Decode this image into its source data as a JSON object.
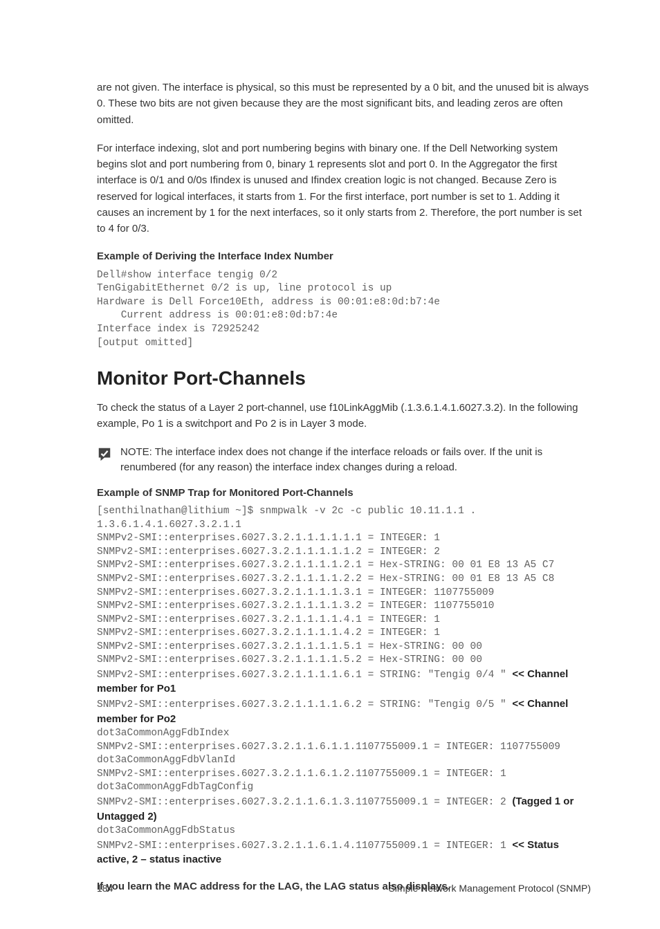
{
  "intro": {
    "p1": "are not given. The interface is physical, so this must be represented by a 0 bit, and the unused bit is always 0. These two bits are not given because they are the most significant bits, and leading zeros are often omitted.",
    "p2": "For interface indexing, slot and port numbering begins with binary one. If the Dell Networking system begins slot and port numbering from 0, binary 1 represents slot and port 0. In the Aggregator the first interface is 0/1 and 0/0s Ifindex is unused and Ifindex creation logic is not changed. Because Zero is reserved for logical interfaces, it starts from 1. For the first interface, port number is set to 1. Adding it causes an increment by 1 for the next interfaces, so it only starts from 2. Therefore, the port number is set to 4 for 0/3."
  },
  "example1": {
    "title": "Example of Deriving the Interface Index Number",
    "code": "Dell#show interface tengig 0/2\nTenGigabitEthernet 0/2 is up, line protocol is up\nHardware is Dell Force10Eth, address is 00:01:e8:0d:b7:4e\n    Current address is 00:01:e8:0d:b7:4e\nInterface index is 72925242\n[output omitted]"
  },
  "section": {
    "title": "Monitor Port-Channels",
    "body": "To check the status of a Layer 2 port-channel, use f10LinkAggMib (.1.3.6.1.4.1.6027.3.2). In the following example, Po 1 is a switchport and Po 2 is in Layer 3 mode."
  },
  "note": {
    "label": "NOTE:",
    "text": " The interface index does not change if the interface reloads or fails over. If the unit is renumbered (for any reason) the interface index changes during a reload."
  },
  "example2": {
    "title": "Example of SNMP Trap for Monitored Port-Channels",
    "lines": [
      {
        "code": "[senthilnathan@lithium ~]$ snmpwalk -v 2c -c public 10.11.1.1 .",
        "anno": ""
      },
      {
        "code": "1.3.6.1.4.1.6027.3.2.1.1",
        "anno": ""
      },
      {
        "code": "SNMPv2-SMI::enterprises.6027.3.2.1.1.1.1.1.1 = INTEGER: 1",
        "anno": ""
      },
      {
        "code": "SNMPv2-SMI::enterprises.6027.3.2.1.1.1.1.1.2 = INTEGER: 2",
        "anno": ""
      },
      {
        "code": "SNMPv2-SMI::enterprises.6027.3.2.1.1.1.1.2.1 = Hex-STRING: 00 01 E8 13 A5 C7",
        "anno": ""
      },
      {
        "code": "SNMPv2-SMI::enterprises.6027.3.2.1.1.1.1.2.2 = Hex-STRING: 00 01 E8 13 A5 C8",
        "anno": ""
      },
      {
        "code": "SNMPv2-SMI::enterprises.6027.3.2.1.1.1.1.3.1 = INTEGER: 1107755009",
        "anno": ""
      },
      {
        "code": "SNMPv2-SMI::enterprises.6027.3.2.1.1.1.1.3.2 = INTEGER: 1107755010",
        "anno": ""
      },
      {
        "code": "SNMPv2-SMI::enterprises.6027.3.2.1.1.1.1.4.1 = INTEGER: 1",
        "anno": ""
      },
      {
        "code": "SNMPv2-SMI::enterprises.6027.3.2.1.1.1.1.4.2 = INTEGER: 1",
        "anno": ""
      },
      {
        "code": "SNMPv2-SMI::enterprises.6027.3.2.1.1.1.1.5.1 = Hex-STRING: 00 00",
        "anno": ""
      },
      {
        "code": "SNMPv2-SMI::enterprises.6027.3.2.1.1.1.1.5.2 = Hex-STRING: 00 00",
        "anno": ""
      },
      {
        "code": "SNMPv2-SMI::enterprises.6027.3.2.1.1.1.1.6.1 = STRING: \"Tengig 0/4 \" ",
        "anno": "<< Channel member for Po1"
      },
      {
        "code": "SNMPv2-SMI::enterprises.6027.3.2.1.1.1.1.6.2 = STRING: \"Tengig 0/5 \" ",
        "anno": "<< Channel member for Po2"
      },
      {
        "code": "dot3aCommonAggFdbIndex",
        "anno": ""
      },
      {
        "code": "SNMPv2-SMI::enterprises.6027.3.2.1.1.6.1.1.1107755009.1 = INTEGER: 1107755009",
        "anno": ""
      },
      {
        "code": "dot3aCommonAggFdbVlanId",
        "anno": ""
      },
      {
        "code": "SNMPv2-SMI::enterprises.6027.3.2.1.1.6.1.2.1107755009.1 = INTEGER: 1",
        "anno": ""
      },
      {
        "code": "dot3aCommonAggFdbTagConfig",
        "anno": ""
      },
      {
        "code": "SNMPv2-SMI::enterprises.6027.3.2.1.1.6.1.3.1107755009.1 = INTEGER: 2 ",
        "anno": "(Tagged 1 or Untagged 2)"
      },
      {
        "code": "dot3aCommonAggFdbStatus",
        "anno": ""
      },
      {
        "code": "SNMPv2-SMI::enterprises.6027.3.2.1.1.6.1.4.1107755009.1 = INTEGER: 1 ",
        "anno": "<< Status active, 2 – status inactive"
      }
    ]
  },
  "closing": "If you learn the MAC address for the LAG, the LAG status also displays.",
  "footer": {
    "page": "184",
    "chapter": "Simple Network Management Protocol (SNMP)"
  }
}
